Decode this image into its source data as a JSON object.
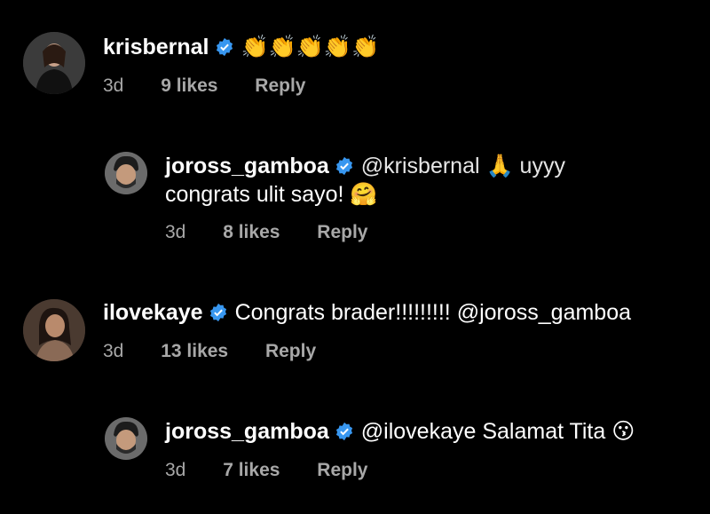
{
  "comments": [
    {
      "username": "krisbernal",
      "text": "👏👏👏👏👏",
      "time": "3d",
      "likes": "9 likes",
      "reply": "Reply"
    },
    {
      "username": "joross_gamboa",
      "text_line1": "@krisbernal 🙏 uyyy",
      "text_line2": "congrats ulit sayo! 🤗",
      "time": "3d",
      "likes": "8 likes",
      "reply": "Reply"
    },
    {
      "username": "ilovekaye",
      "text": "Congrats brader!!!!!!!!! @joross_gamboa",
      "time": "3d",
      "likes": "13 likes",
      "reply": "Reply"
    },
    {
      "username": "joross_gamboa",
      "text": "@ilovekaye Salamat Tita 😗",
      "time": "3d",
      "likes": "7 likes",
      "reply": "Reply"
    }
  ],
  "colors": {
    "verified": "#3897f0",
    "meta": "#a8a8a8",
    "background": "#000000"
  }
}
